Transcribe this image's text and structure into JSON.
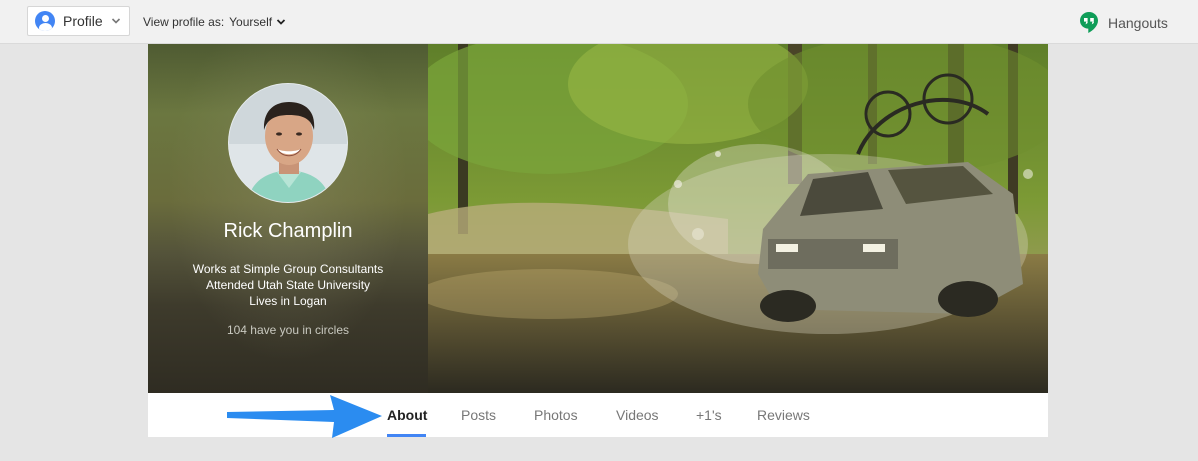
{
  "topbar": {
    "profile_label": "Profile",
    "view_as_label": "View profile as:",
    "view_as_value": "Yourself",
    "hangouts_label": "Hangouts"
  },
  "profile": {
    "name": "Rick Champlin",
    "work": "Works at Simple Group Consultants",
    "education": "Attended Utah State University",
    "location": "Lives in Logan",
    "circles": "104 have you in circles"
  },
  "tabs": [
    {
      "label": "About",
      "active": true
    },
    {
      "label": "Posts",
      "active": false
    },
    {
      "label": "Photos",
      "active": false
    },
    {
      "label": "Videos",
      "active": false
    },
    {
      "label": "+1's",
      "active": false
    },
    {
      "label": "Reviews",
      "active": false
    }
  ],
  "colors": {
    "accent": "#4285f4",
    "hangouts_green": "#0f9d58",
    "annotation_arrow": "#2b8cf0"
  },
  "icons": {
    "profile": "person-circle-icon",
    "hangouts": "hangouts-quote-icon",
    "dropdown": "chevron-down-icon"
  }
}
